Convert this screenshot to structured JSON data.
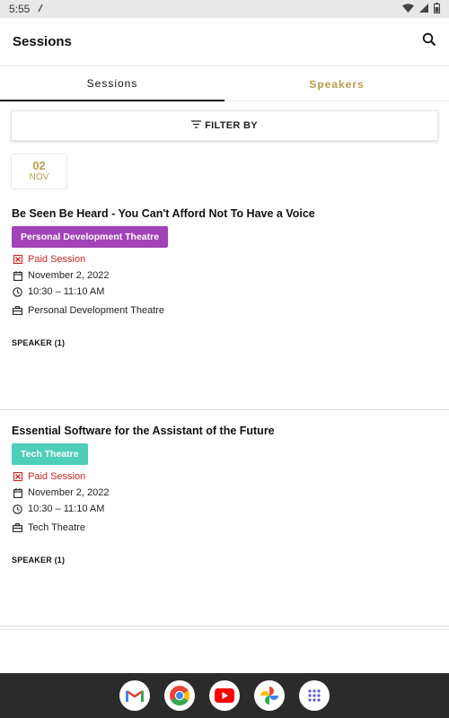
{
  "status": {
    "time": "5:55"
  },
  "appbar": {
    "title": "Sessions"
  },
  "tabs": [
    {
      "label": "Sessions"
    },
    {
      "label": "Speakers"
    }
  ],
  "filter": {
    "label": "FILTER BY"
  },
  "date": {
    "day": "02",
    "month": "NOV"
  },
  "sessions": [
    {
      "title": "Be Seen Be Heard - You Can't Afford Not To Have a Voice",
      "badge": "Personal Development Theatre",
      "badge_color": "#a142b8",
      "paid": "Paid Session",
      "date": "November 2, 2022",
      "time": "10:30 – 11:10 AM",
      "location": "Personal Development Theatre",
      "speaker": "SPEAKER (1)"
    },
    {
      "title": "Essential Software for the Assistant of the Future",
      "badge": "Tech Theatre",
      "badge_color": "#4ecdb9",
      "paid": "Paid Session",
      "date": "November 2, 2022",
      "time": "10:30 – 11:10 AM",
      "location": "Tech Theatre",
      "speaker": "SPEAKER (1)"
    }
  ],
  "icons": {
    "search": "search-icon",
    "filter": "filter-icon",
    "paid": "paid-icon",
    "calendar": "calendar-icon",
    "clock": "clock-icon",
    "location": "briefcase-icon"
  }
}
